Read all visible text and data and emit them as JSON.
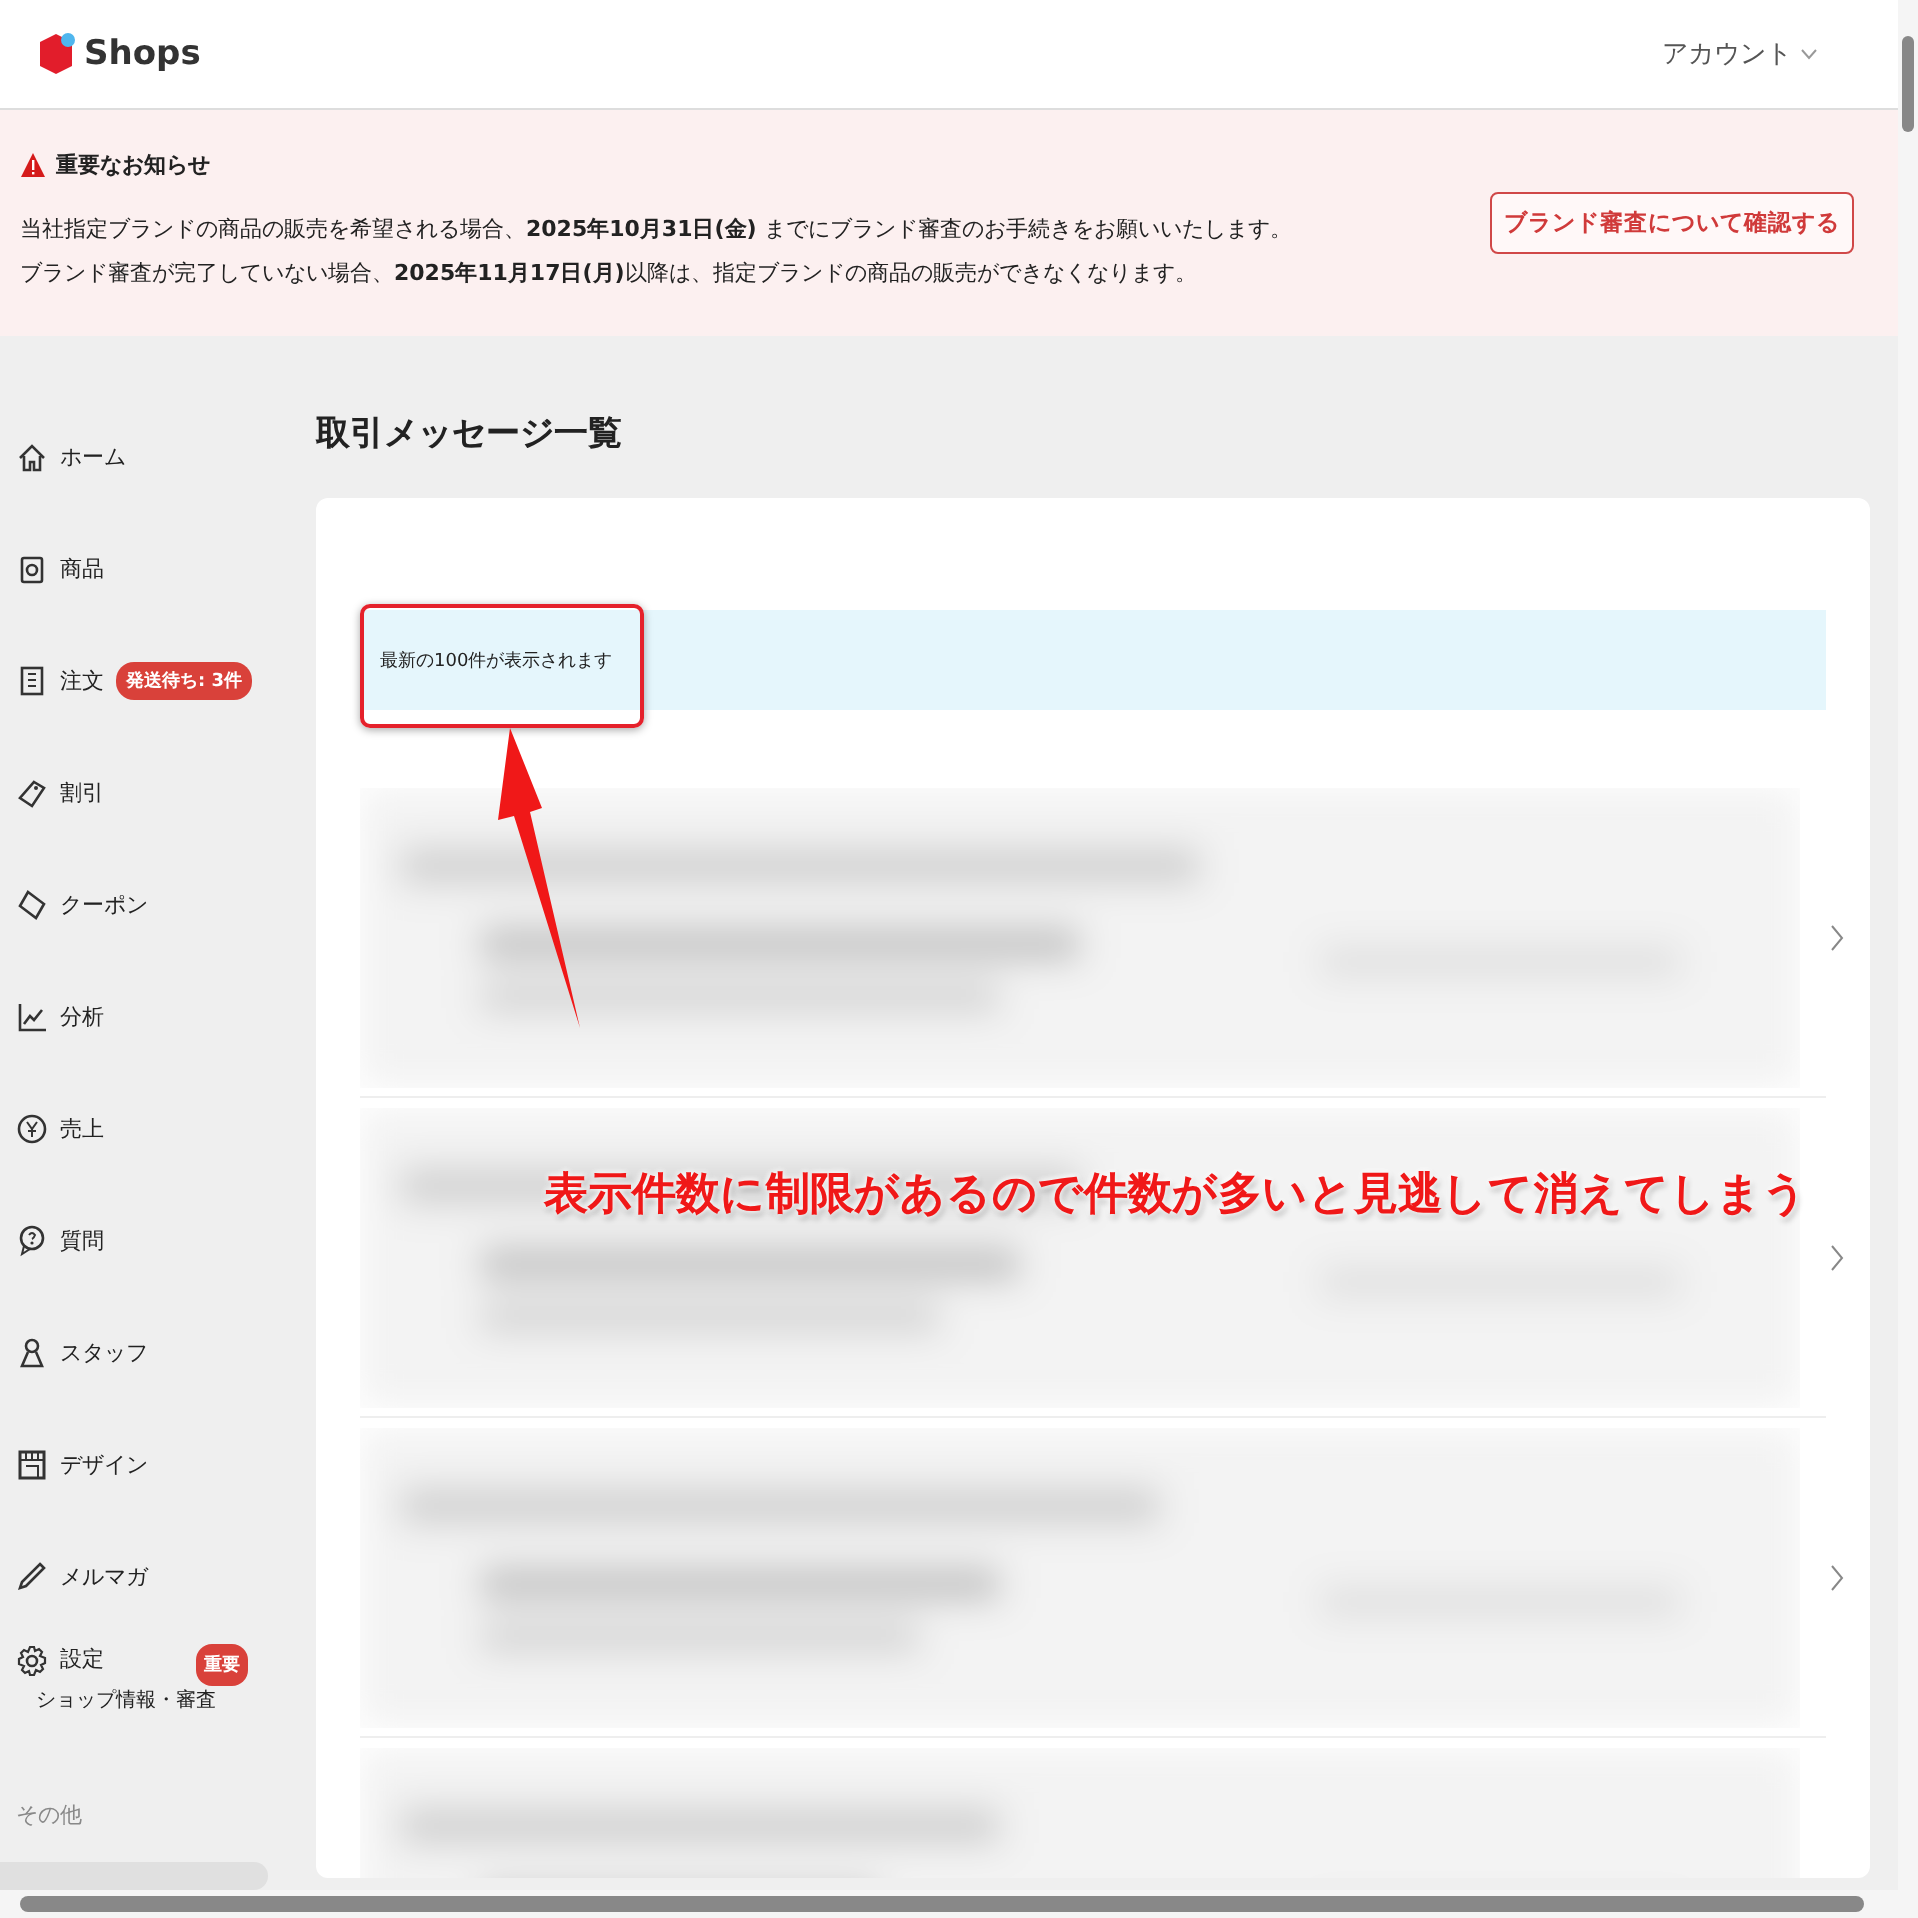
{
  "header": {
    "logo_text": "Shops",
    "account": "アカウント"
  },
  "notice": {
    "title": "重要なお知らせ",
    "lines": [
      "当社指定ブランドの商品の販売を希望される場合、**2025年10月31日(金)** までにブランド審査のお手続きをお願いいたします。",
      "ブランド審査が完了していない場合、**2025年11月17日(月)**以降は、指定ブランドの商品の販売ができなくなります。"
    ],
    "button": "ブランド審査について確認する"
  },
  "sidebar": {
    "items": [
      {
        "label": "ホーム"
      },
      {
        "label": "商品"
      },
      {
        "label": "注文",
        "badge": "発送待ち: 3件"
      },
      {
        "label": "割引"
      },
      {
        "label": "クーポン"
      },
      {
        "label": "分析"
      },
      {
        "label": "売上"
      },
      {
        "label": "質問"
      },
      {
        "label": "スタッフ"
      },
      {
        "label": "デザイン"
      },
      {
        "label": "メルマガ"
      },
      {
        "label": "設定",
        "badge": "重要",
        "sublabel": "ショップ情報・審査"
      }
    ],
    "section_label": "その他"
  },
  "page_title": "取引メッセージ一覧",
  "info_bar": "最新の100件が表示されます",
  "message_rows": [
    {
      "kind": "blurred"
    },
    {
      "kind": "blurred"
    },
    {
      "kind": "blurred"
    },
    {
      "kind": "blurred_cut"
    }
  ],
  "annotation": {
    "text": "表示件数に制限があるので件数が多いと見逃して消えてしまう"
  }
}
